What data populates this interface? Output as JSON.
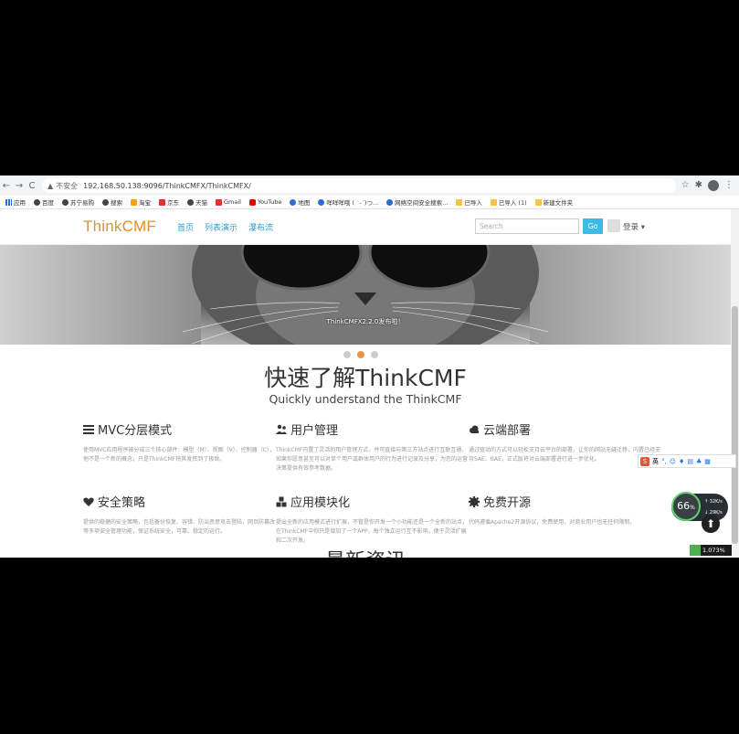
{
  "browser": {
    "nav": {
      "back": "←",
      "forward": "→",
      "reload": "C"
    },
    "security": "不安全",
    "url": "192.168.50.138:9096/ThinkCMFX/ThinkCMFX/",
    "icons": [
      "star-icon",
      "extension-icon",
      "profile-icon",
      "menu-icon"
    ]
  },
  "bookmarks": [
    {
      "label": "应用",
      "icon": "apps-grid-icon",
      "color": "grid"
    },
    {
      "label": "百度",
      "icon": "globe-icon",
      "color": ""
    },
    {
      "label": "苏宁易购",
      "icon": "globe-icon",
      "color": ""
    },
    {
      "label": "搜索",
      "icon": "globe-icon",
      "color": ""
    },
    {
      "label": "淘宝",
      "icon": "taobao-icon",
      "color": "orange"
    },
    {
      "label": "京东",
      "icon": "jd-icon",
      "color": "red"
    },
    {
      "label": "天猫",
      "icon": "globe-icon",
      "color": ""
    },
    {
      "label": "Gmail",
      "icon": "gmail-icon",
      "color": "red"
    },
    {
      "label": "YouTube",
      "icon": "youtube-icon",
      "color": "yt"
    },
    {
      "label": "地图",
      "icon": "maps-icon",
      "color": "blue"
    },
    {
      "label": "咩咩咩哦 ( ˙-˙)つ...",
      "icon": "site-icon",
      "color": "blue"
    },
    {
      "label": "网络空间安全搜索...",
      "icon": "site-icon",
      "color": "blue"
    },
    {
      "label": "已导入",
      "icon": "folder-icon",
      "color": "folder"
    },
    {
      "label": "已导入 (1)",
      "icon": "folder-icon",
      "color": "folder"
    },
    {
      "label": "新建文件夹",
      "icon": "folder-icon",
      "color": "folder"
    }
  ],
  "site": {
    "logo_a": "Think",
    "logo_b": "CMF",
    "nav": [
      "首页",
      "列表演示",
      "瀑布流"
    ],
    "search_placeholder": "Search",
    "go": "Go",
    "login": "登录 ▾"
  },
  "carousel": {
    "caption": "ThinkCMFX2.2.0发布啦！",
    "slides": 3,
    "active": 1
  },
  "hero": {
    "title": "快速了解ThinkCMF",
    "subtitle": "Quickly understand the ThinkCMF"
  },
  "features": [
    {
      "title": "MVC分层模式",
      "icon": "list-icon",
      "desc": "使用MVC应用程序被分成三个核心部件：模型（M）、视图（V）、控制器（C），他不是一个新的概念，只是ThinkCMF将其发挥到了极致。"
    },
    {
      "title": "用户管理",
      "icon": "users-icon",
      "desc": "ThinkCMF内置了灵活的用户管理方式，并可直接与第三方站点进行互联互通，如果你愿意甚至可以对单个用户或群体用户的行为进行记录及分享，为您的运营决策提供有效参考数据。"
    },
    {
      "title": "云端部署",
      "icon": "cloud-icon",
      "desc": "通过驱动的方式可以轻松支持云平台的部署，让你的网站无缝迁移，内置已经支持SAE、BAE，正式版将对云端部署进行进一步优化。"
    },
    {
      "title": "安全策略",
      "icon": "heart-icon",
      "desc": "提供的稳健的安全策略，包括备份恢复、容错、防治恶意攻击登陆，网页防篡改等多项安全管理功能，保证系统安全，可靠、稳定的运行。"
    },
    {
      "title": "应用模块化",
      "icon": "cubes-icon",
      "desc": "提出全新的应用模式进行扩展，不管是你开发一个小功能还是一个全新的站点，在ThinkCMF中你只是增加了一个APP，每个独立运行互不影响，便于灵活扩展和二次开发。"
    },
    {
      "title": "免费开源",
      "icon": "certificate-icon",
      "desc": "代码遵循Apache2开源协议，免费使用，对商业用户也无任何限制。"
    }
  ],
  "more_title": "最新资讯",
  "ime": {
    "logo": "S",
    "lang": "英"
  },
  "speed": {
    "percent": "66",
    "unit": "%",
    "up": "↑ 32K/s",
    "down": "↓ 29K/s"
  },
  "badge": "1.073%"
}
